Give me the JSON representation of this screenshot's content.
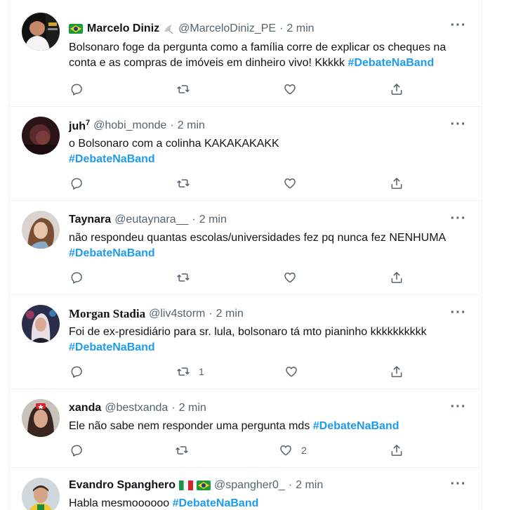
{
  "tweets": [
    {
      "name": "Marcelo Diniz",
      "handle": "@MarceloDiniz_PE",
      "sep": "·",
      "time": "2 min",
      "text": "Bolsonaro foge da pergunta como a família corre de explicar os cheques na conta e as compras de imóveis em dinheiro vivo! Kkkkk",
      "hashtag": "#DebateNaBand",
      "reply_count": "",
      "retweet_count": "",
      "like_count": "",
      "flag": "brazil",
      "avatar_color": "#b9332d"
    },
    {
      "name": "juh",
      "name_sup": "7",
      "handle": "@hobi_monde",
      "sep": "·",
      "time": "2 min",
      "text": "o Bolsonaro com a colinha KAKAKAKAKK",
      "hashtag": "#DebateNaBand",
      "avatar_color": "#3a1c1f"
    },
    {
      "name": "Taynara",
      "handle": "@eutaynara__",
      "sep": "·",
      "time": "2 min",
      "text": "não respondeu quantas escolas/universidades fez pq nunca fez NENHUMA",
      "hashtag": "#DebateNaBand",
      "avatar_color": "#c9a795"
    },
    {
      "name": "Morgan Stadia",
      "handle": "@liv4storm",
      "sep": "·",
      "time": "2 min",
      "text": "Foi de ex-presidiário para sr. lula, bolsonaro tá mto pianinho kkkkkkkkkk",
      "hashtag": "#DebateNaBand",
      "retweet_count": "1",
      "avatar_color": "#6a5870"
    },
    {
      "name": "xanda",
      "handle": "@bestxanda",
      "sep": "·",
      "time": "2 min",
      "text": "Ele não sabe nem responder uma pergunta mds",
      "hashtag": "#DebateNaBand",
      "like_count": "2",
      "avatar_color": "#5a3a30"
    },
    {
      "name": "Evandro Spanghero",
      "handle": "@spangher0_",
      "sep": "·",
      "time": "2 min",
      "text": "Habla mesmoooooo",
      "hashtag": "#DebateNaBand",
      "avatar_color": "#e7c43a"
    }
  ],
  "icons": {
    "reply": "reply-icon",
    "retweet": "retweet-icon",
    "like": "like-icon",
    "share": "share-icon",
    "more": "more-icon"
  },
  "colors": {
    "accent": "#1d9bf0",
    "muted": "#536471",
    "border": "#eff3f4"
  }
}
